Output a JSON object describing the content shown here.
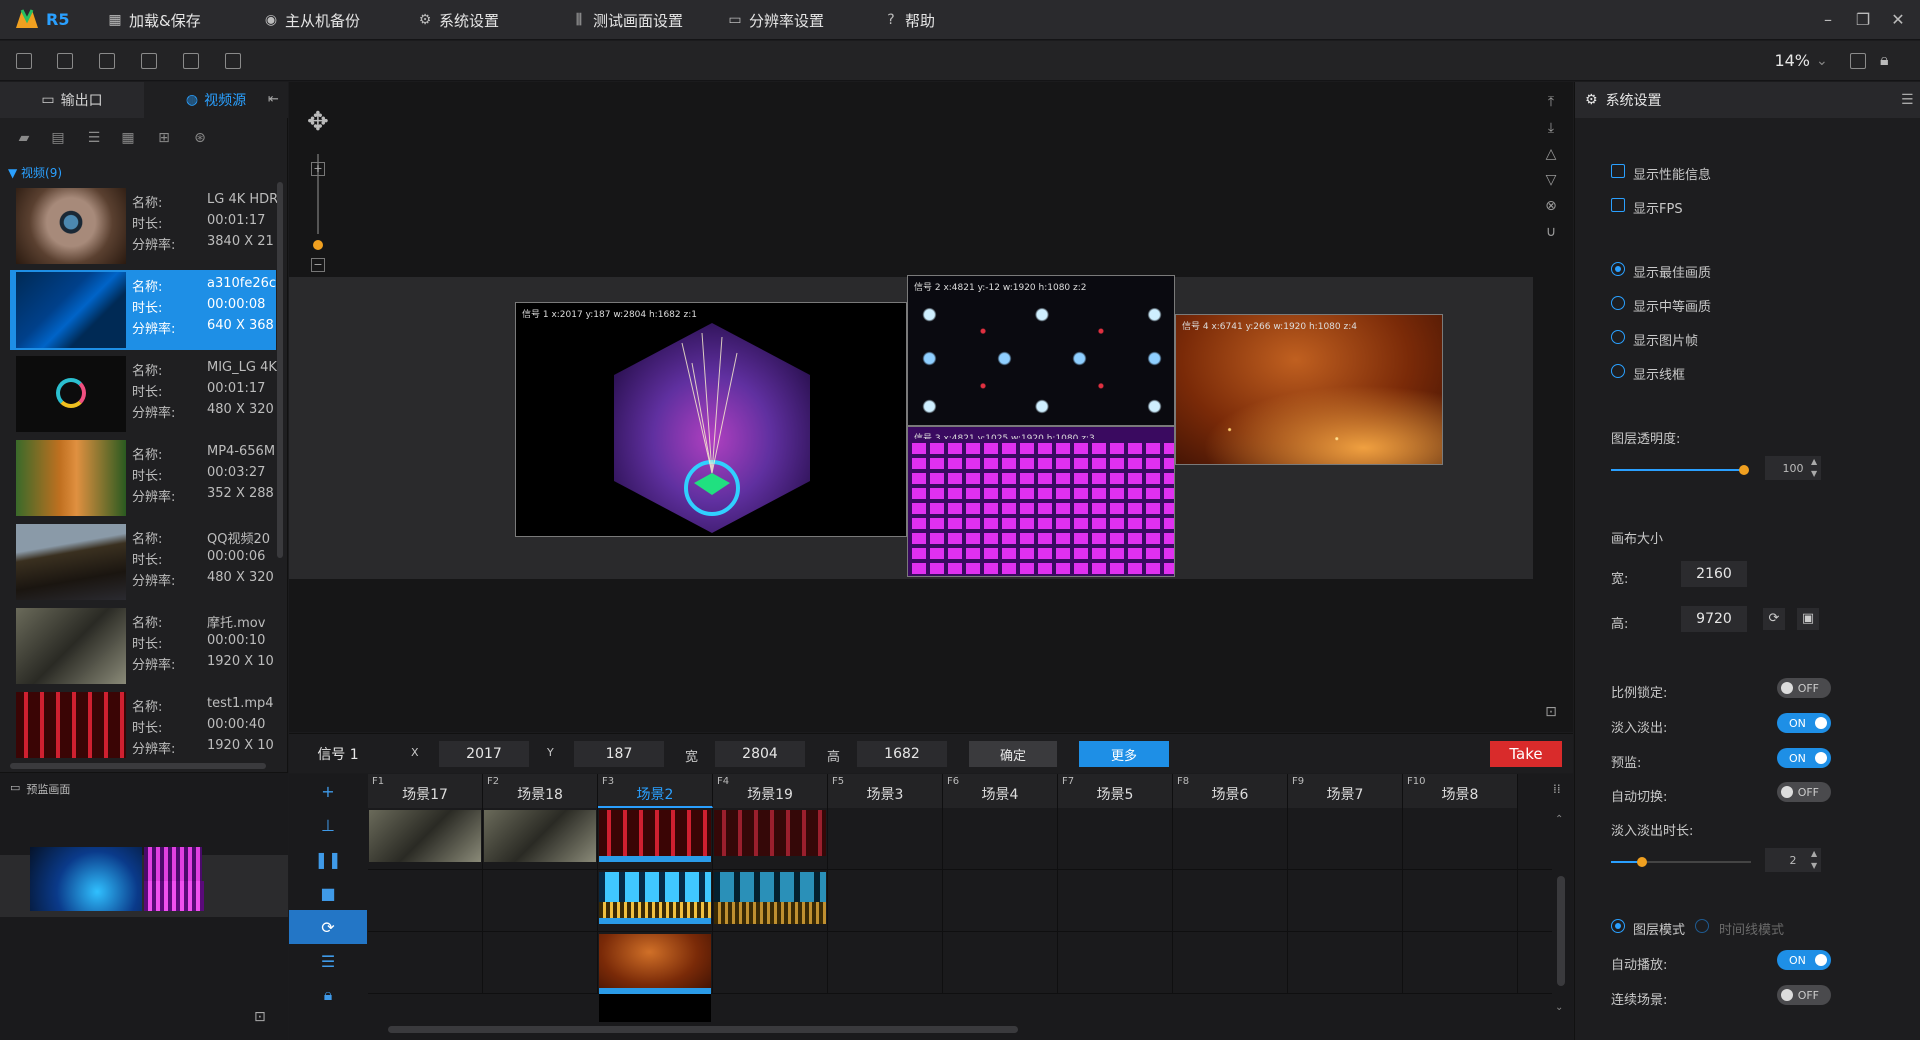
{
  "app": {
    "name": "R5"
  },
  "menu": [
    "加载&保存",
    "主从机备份",
    "系统设置",
    "测试画面设置",
    "分辨率设置",
    "帮助"
  ],
  "toolbar": {
    "zoom": "14%"
  },
  "left": {
    "tabs": [
      "输出口",
      "视频源"
    ],
    "group_label": "视频(9)",
    "field_labels": {
      "name": "名称:",
      "duration": "时长:",
      "resolution": "分辨率:"
    },
    "videos": [
      {
        "name": "LG 4K HDR",
        "duration": "00:01:17",
        "resolution": "3840 X 21"
      },
      {
        "name": "a310fe26c",
        "duration": "00:00:08",
        "resolution": "640 X 368"
      },
      {
        "name": "MIG_LG 4K",
        "duration": "00:01:17",
        "resolution": "480 X 320"
      },
      {
        "name": "MP4-656M",
        "duration": "00:03:27",
        "resolution": "352 X 288"
      },
      {
        "name": "QQ视频20",
        "duration": "00:00:06",
        "resolution": "480 X 320"
      },
      {
        "name": "摩托.mov",
        "duration": "00:00:10",
        "resolution": "1920 X 10"
      },
      {
        "name": "test1.mp4",
        "duration": "00:00:40",
        "resolution": "1920 X 10"
      }
    ],
    "preview_label": "预监画面"
  },
  "canvas": {
    "layer1_title": "信号 1  x:2017  y:187  w:2804  h:1682  z:1",
    "layer2_title": "信号 2  x:4821  y:-12  w:1920  h:1080  z:2",
    "layer3_title": "信号 3  x:4821  y:1025  w:1920  h:1080  z:3",
    "layer4_title": "信号 4  x:6741  y:266  w:1920  h:1080  z:4"
  },
  "props": {
    "signal": "信号 1",
    "x_label": "X",
    "x": "2017",
    "y_label": "Y",
    "y": "187",
    "w_label": "宽",
    "w": "2804",
    "h_label": "高",
    "h": "1682",
    "confirm": "确定",
    "more": "更多",
    "take": "Take"
  },
  "scenes": [
    {
      "key": "F1",
      "name": "场景17"
    },
    {
      "key": "F2",
      "name": "场景18"
    },
    {
      "key": "F3",
      "name": "场景2"
    },
    {
      "key": "F4",
      "name": "场景19"
    },
    {
      "key": "F5",
      "name": "场景3"
    },
    {
      "key": "F6",
      "name": "场景4"
    },
    {
      "key": "F7",
      "name": "场景5"
    },
    {
      "key": "F8",
      "name": "场景6"
    },
    {
      "key": "F9",
      "name": "场景7"
    },
    {
      "key": "F10",
      "name": "场景8"
    }
  ],
  "right": {
    "title": "系统设置",
    "show_perf": "显示性能信息",
    "show_fps": "显示FPS",
    "q_best": "显示最佳画质",
    "q_mid": "显示中等画质",
    "q_frame": "显示图片帧",
    "q_wire": "显示线框",
    "opacity_label": "图层透明度:",
    "opacity": "100",
    "canvas_size": "画布大小",
    "width_label": "宽:",
    "width": "2160",
    "height_label": "高:",
    "height": "9720",
    "ratio_lock": "比例锁定:",
    "fade": "淡入淡出:",
    "preview": "预监:",
    "auto_switch": "自动切换:",
    "fade_dur_label": "淡入淡出时长:",
    "fade_dur": "2",
    "layer_mode": "图层模式",
    "timeline_mode": "时间线模式",
    "auto_play": "自动播放:",
    "continuous": "连续场景:",
    "on": "ON",
    "off": "OFF"
  }
}
